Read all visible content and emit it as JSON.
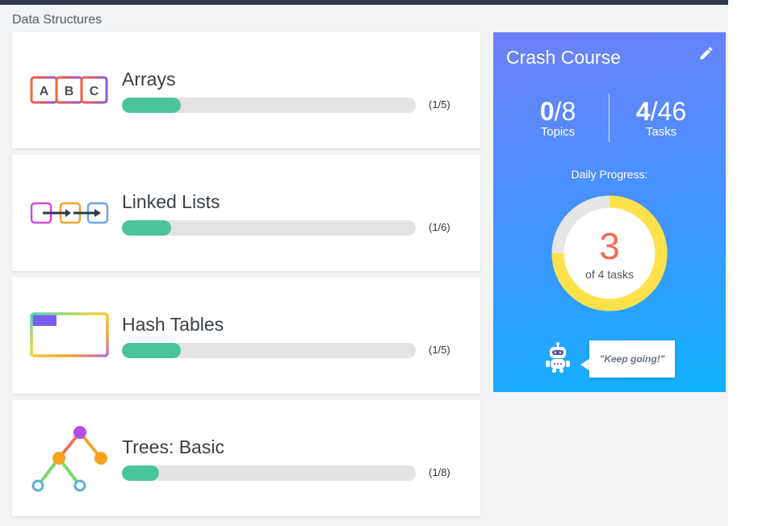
{
  "section": {
    "title": "Data Structures"
  },
  "topics": [
    {
      "name": "Arrays",
      "progress_label": "(1/5)",
      "progress": 0.2,
      "icon": "abc-blocks-icon"
    },
    {
      "name": "Linked Lists",
      "progress_label": "(1/6)",
      "progress": 0.167,
      "icon": "linked-list-icon"
    },
    {
      "name": "Hash Tables",
      "progress_label": "(1/5)",
      "progress": 0.2,
      "icon": "hash-table-icon"
    },
    {
      "name": "Trees: Basic",
      "progress_label": "(1/8)",
      "progress": 0.125,
      "icon": "tree-icon"
    }
  ],
  "arrays_icon_letters": [
    "A",
    "B",
    "C"
  ],
  "crash_course": {
    "title": "Crash Course",
    "topics_done": "0",
    "topics_total": "/8",
    "topics_label": "Topics",
    "tasks_done": "4",
    "tasks_total": "/46",
    "tasks_label": "Tasks",
    "daily_label": "Daily Progress:",
    "daily_done": "3",
    "daily_sub": "of 4 tasks",
    "daily_progress": 0.75,
    "message": "\"Keep going!\""
  },
  "colors": {
    "accent_green": "#4cc49a",
    "ring_yellow": "#ffe14b",
    "ring_track": "#e6e6e6",
    "number_red": "#f26b55"
  }
}
